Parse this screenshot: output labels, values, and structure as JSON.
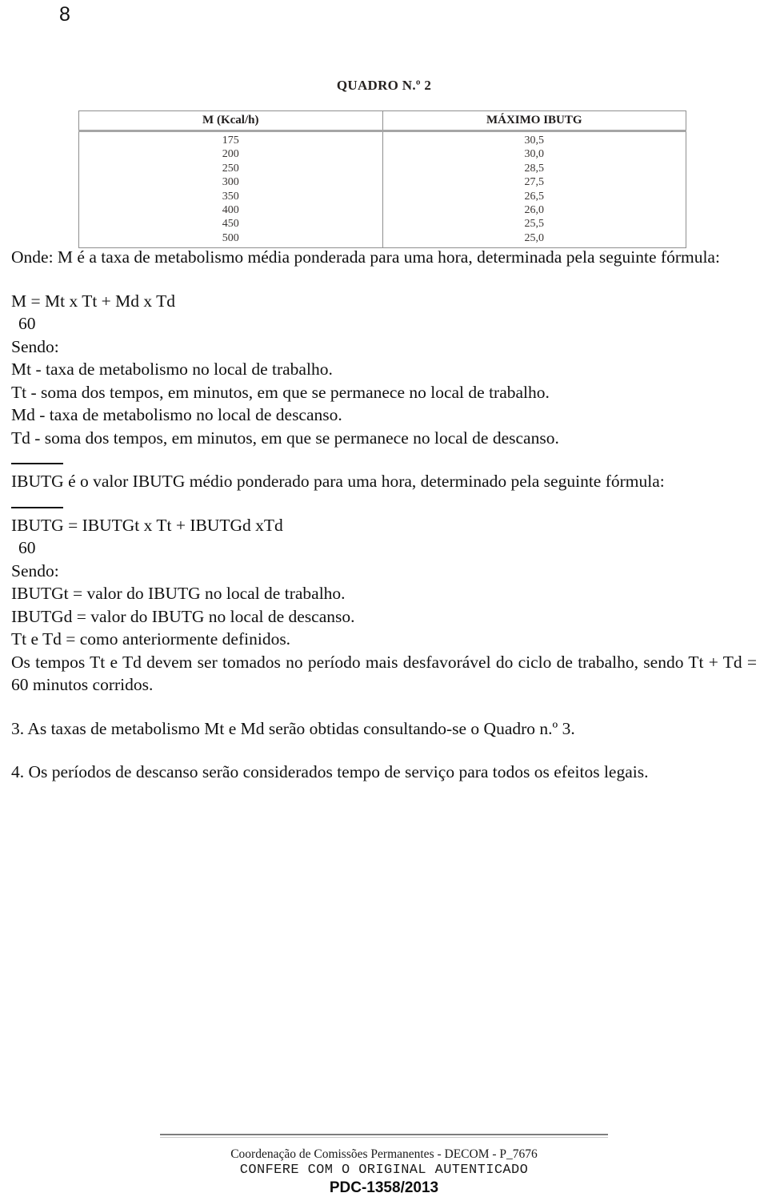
{
  "page": {
    "number": "8"
  },
  "quadro": {
    "title": "QUADRO N.º 2",
    "headers": [
      "M (Kcal/h)",
      "MÁXIMO IBUTG"
    ],
    "rows": [
      [
        "175",
        "30,5"
      ],
      [
        "200",
        "30,0"
      ],
      [
        "250",
        "28,5"
      ],
      [
        "300",
        "27,5"
      ],
      [
        "350",
        "26,5"
      ],
      [
        "400",
        "26,0"
      ],
      [
        "450",
        "25,5"
      ],
      [
        "500",
        "25,0"
      ]
    ]
  },
  "body": {
    "onde_paragraph": "Onde: M é a taxa de metabolismo média ponderada para uma hora, determinada pela seguinte fórmula:",
    "formula_m": "M = Mt x Tt + Md x Td",
    "formula_m_denominator": "60",
    "sendo_label_1": "Sendo:",
    "definitions_1": [
      "Mt - taxa de metabolismo no local de trabalho.",
      "Tt - soma dos tempos, em minutos, em que se permanece no local de trabalho.",
      "Md - taxa de metabolismo no local de descanso.",
      "Td - soma dos tempos, em minutos, em que se permanece no local de descanso."
    ],
    "ibutg_bar_label": "IBUTG",
    "ibutg_paragraph_rest": " é o valor IBUTG médio ponderado para uma hora, determinado pela seguinte fórmula:",
    "formula_ibutg_bar": "IBUTG",
    "formula_ibutg_rest": " = IBUTGt x Tt + IBUTGd xTd",
    "formula_ibutg_denominator": "60",
    "sendo_label_2": "Sendo:",
    "definitions_2": [
      "IBUTGt = valor do IBUTG no local de trabalho.",
      "IBUTGd = valor do IBUTG no local de descanso.",
      "Tt e Td = como anteriormente definidos."
    ],
    "tempos_paragraph": "Os tempos Tt e Td devem ser tomados no período mais desfavorável do ciclo de trabalho, sendo Tt + Td = 60 minutos corridos.",
    "item_3": "3. As taxas de metabolismo Mt e Md serão obtidas consultando-se o Quadro n.º 3.",
    "item_4": "4. Os períodos de descanso serão considerados tempo de serviço para todos os efeitos legais."
  },
  "footer": {
    "line_1": "Coordenação de Comissões Permanentes - DECOM - P_7676",
    "line_2": "CONFERE COM O ORIGINAL AUTENTICADO",
    "line_3": "PDC-1358/2013"
  }
}
